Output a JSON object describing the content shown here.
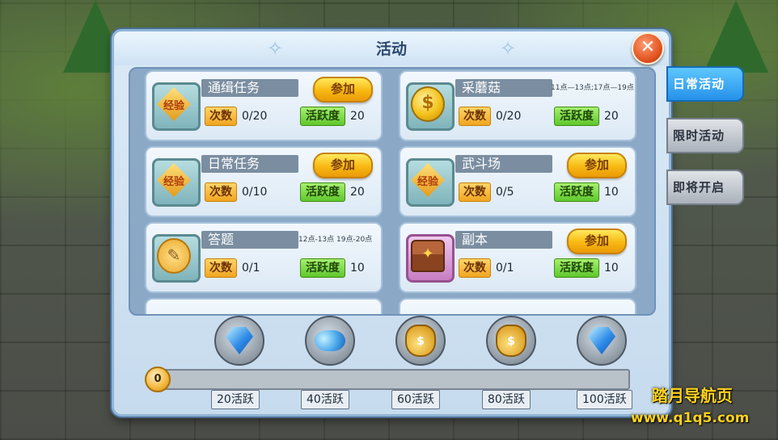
{
  "panel": {
    "title": "活动",
    "close_icon": "close-x-icon"
  },
  "side_tabs": [
    {
      "label": "日常活动",
      "active": true
    },
    {
      "label": "限时活动",
      "active": false
    },
    {
      "label": "即将开启",
      "active": false
    }
  ],
  "labels": {
    "count": "次数",
    "activity": "活跃度",
    "join": "参加"
  },
  "activities": [
    {
      "name": "通缉任务",
      "icon": "exp-badge-icon",
      "icon_text": "经验",
      "count": "0/20",
      "points": "20",
      "join": true,
      "time": ""
    },
    {
      "name": "采蘑菇",
      "icon": "gold-coin-icon",
      "icon_text": "$",
      "count": "0/20",
      "points": "20",
      "join": false,
      "time": "11点—13点;17点—19点"
    },
    {
      "name": "日常任务",
      "icon": "exp-badge-icon",
      "icon_text": "经验",
      "count": "0/10",
      "points": "20",
      "join": true,
      "time": ""
    },
    {
      "name": "武斗场",
      "icon": "exp-badge-icon",
      "icon_text": "经验",
      "count": "0/5",
      "points": "10",
      "join": true,
      "time": ""
    },
    {
      "name": "答题",
      "icon": "scroll-icon",
      "icon_text": "✎",
      "count": "0/1",
      "points": "10",
      "join": false,
      "time": "12点-13点    19点-20点"
    },
    {
      "name": "副本",
      "icon": "treasure-chest-icon",
      "icon_text": "✦",
      "count": "0/1",
      "points": "10",
      "join": true,
      "time": ""
    }
  ],
  "rewards": [
    {
      "icon": "blue-gem-icon",
      "threshold": "20活跃"
    },
    {
      "icon": "gem-pile-icon",
      "threshold": "40活跃"
    },
    {
      "icon": "money-bag-icon",
      "threshold": "60活跃"
    },
    {
      "icon": "money-bag-icon",
      "threshold": "80活跃"
    },
    {
      "icon": "blue-gem-icon",
      "threshold": "100活跃"
    }
  ],
  "progress": {
    "value": "0",
    "fraction": 0
  },
  "watermark": {
    "line1": "踏月导航页",
    "line2": "www.q1q5.com"
  },
  "colors": {
    "accent_blue": "#2591e8",
    "join_yellow": "#f8b812",
    "count_orange": "#f1a521",
    "activity_green": "#5fc72c"
  }
}
